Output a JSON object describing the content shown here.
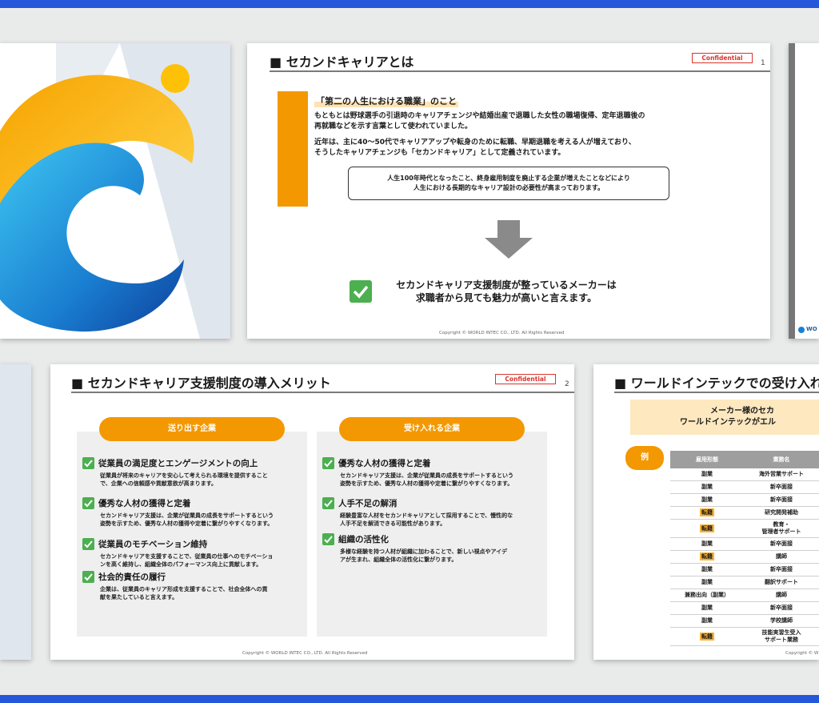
{
  "slides": {
    "second_career": {
      "title": "■ セカンドキャリアとは",
      "confidential": "Confidential",
      "page": "1",
      "highlight": "「第二の人生における職業」のこと",
      "para1_line1": "もともとは野球選手の引退時のキャリアチェンジや結婚出産で退職した女性の職場復帰、定年退職後の",
      "para1_line2": "再就職などを示す言葉として使われていました。",
      "para2_line1": "近年は、主に40～50代でキャリアアップや転身のために転職、早期退職を考える人が増えており、",
      "para2_line2": "そうしたキャリアチェンジも「セカンドキャリア」として定義されています。",
      "box_line1": "人生100年時代となったこと、終身雇用制度を廃止する企業が増えたことなどにより",
      "box_line2": "人生における長期的なキャリア設計の必要性が高まっております。",
      "conclusion_line1": "セカンドキャリア支援制度が整っているメーカーは",
      "conclusion_line2": "求職者から見ても魅力が高いと言えます。",
      "copyright": "Copyright © WORLD INTEC CO., LTD. All Rights Reserved"
    },
    "merits": {
      "title": "■ セカンドキャリア支援制度の導入メリット",
      "confidential": "Confidential",
      "page": "2",
      "left_label": "送り出す企業",
      "right_label": "受け入れる企業",
      "left_items": [
        {
          "heading": "従業員の満足度とエンゲージメントの向上",
          "line1": "従業員が将来のキャリアを安心して考えられる環境を提供すること",
          "line2": "で、企業への信頼感や貢献意欲が高まります。"
        },
        {
          "heading": "優秀な人材の獲得と定着",
          "line1": "セカンドキャリア支援は、企業が従業員の成長をサポートするという",
          "line2": "姿勢を示すため、優秀な人材の獲得や定着に繋がりやすくなります。"
        },
        {
          "heading": "従業員のモチベーション維持",
          "line1": "セカンドキャリアを支援することで、従業員の仕事へのモチベーショ",
          "line2": "ンを高く維持し、組織全体のパフォーマンス向上に貢献します。"
        },
        {
          "heading": "社会的責任の履行",
          "line1": "企業は、従業員のキャリア形成を支援することで、社会全体への貢",
          "line2": "献を果たしていると言えます。"
        }
      ],
      "right_items": [
        {
          "heading": "優秀な人材の獲得と定着",
          "line1": "セカンドキャリア支援は、企業が従業員の成長をサポートするという",
          "line2": "姿勢を示すため、優秀な人材の獲得や定着に繋がりやすくなります。"
        },
        {
          "heading": "人手不足の解消",
          "line1": "経験豊富な人材をセカンドキャリアとして採用することで、慢性的な",
          "line2": "人手不足を解消できる可能性があります。"
        },
        {
          "heading": "組織の活性化",
          "line1": "多様な経験を持つ人材が組織に加わることで、新しい視点やアイデ",
          "line2": "アが生まれ、組織全体の活性化に繋がります。"
        }
      ],
      "copyright": "Copyright © WORLD INTEC CO., LTD. All Rights Reserved"
    },
    "acceptance": {
      "title": "■ ワールドインテックでの受け入れ",
      "banner_line1": "メーカー様のセカ",
      "banner_line2": "ワールドインテックがエル",
      "example_label": "例",
      "table_headers": [
        "雇用形態",
        "業務名"
      ],
      "rows": [
        {
          "type": "副業",
          "job1": "海外営業サポート",
          "job2": "",
          "tag": false
        },
        {
          "type": "副業",
          "job1": "新卒面接",
          "job2": "",
          "tag": false
        },
        {
          "type": "副業",
          "job1": "新卒面接",
          "job2": "",
          "tag": false
        },
        {
          "type": "転籍",
          "job1": "研究開発補助",
          "job2": "",
          "tag": true
        },
        {
          "type": "転籍",
          "job1": "教育・",
          "job2": "管理者サポート",
          "tag": true
        },
        {
          "type": "副業",
          "job1": "新卒面接",
          "job2": "",
          "tag": false
        },
        {
          "type": "転籍",
          "job1": "講師",
          "job2": "",
          "tag": true
        },
        {
          "type": "副業",
          "job1": "新卒面接",
          "job2": "",
          "tag": false
        },
        {
          "type": "副業",
          "job1": "翻訳サポート",
          "job2": "",
          "tag": false
        },
        {
          "type": "兼務出向（副業）",
          "job1": "講師",
          "job2": "",
          "tag": false
        },
        {
          "type": "副業",
          "job1": "新卒面接",
          "job2": "",
          "tag": false
        },
        {
          "type": "副業",
          "job1": "学校講師",
          "job2": "",
          "tag": false
        },
        {
          "type": "転籍",
          "job1": "技能実習生受入",
          "job2": "サポート業務",
          "tag": true
        }
      ],
      "copyright": "Copyright © W"
    },
    "logo_partial": {
      "text": "WO"
    }
  },
  "colors": {
    "band": "#2457d9",
    "accent": "#f39800",
    "check": "#4caf50",
    "confidential": "#d9342b"
  },
  "icons": [
    "logo-mark-icon",
    "check-icon",
    "down-arrow-icon"
  ]
}
